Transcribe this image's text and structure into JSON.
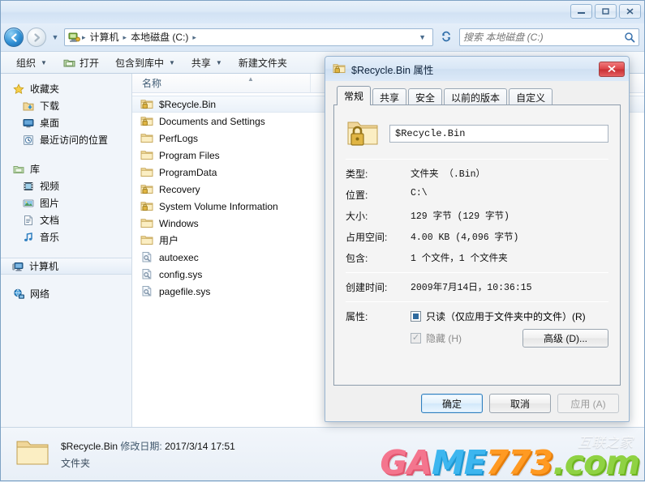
{
  "window": {
    "controls": {
      "minimize": "minimize-icon",
      "maximize": "maximize-icon",
      "close": "close-icon"
    }
  },
  "nav": {
    "back_label": "←",
    "forward_label": "→",
    "history_caret": "▼",
    "refresh_label": "↻",
    "breadcrumbs": [
      "计算机",
      "本地磁盘 (C:)"
    ],
    "separator": "▸"
  },
  "search": {
    "placeholder": "搜索 本地磁盘 (C:)",
    "value": ""
  },
  "toolbar": {
    "items": [
      {
        "label": "组织",
        "caret": true,
        "icon": null
      },
      {
        "label": "打开",
        "caret": false,
        "icon": "open-folder-icon"
      },
      {
        "label": "包含到库中",
        "caret": true,
        "icon": null
      },
      {
        "label": "共享",
        "caret": true,
        "icon": null
      },
      {
        "label": "新建文件夹",
        "caret": false,
        "icon": null
      }
    ]
  },
  "sidebar": {
    "groups": [
      {
        "header": {
          "label": "收藏夹",
          "icon": "star-icon"
        },
        "items": [
          {
            "label": "下载",
            "icon": "downloads-icon"
          },
          {
            "label": "桌面",
            "icon": "desktop-icon"
          },
          {
            "label": "最近访问的位置",
            "icon": "recent-places-icon"
          }
        ]
      },
      {
        "header": {
          "label": "库",
          "icon": "library-icon"
        },
        "items": [
          {
            "label": "视频",
            "icon": "video-icon"
          },
          {
            "label": "图片",
            "icon": "pictures-icon"
          },
          {
            "label": "文档",
            "icon": "documents-icon"
          },
          {
            "label": "音乐",
            "icon": "music-icon"
          }
        ]
      },
      {
        "header": {
          "label": "计算机",
          "icon": "computer-icon",
          "selected": true
        },
        "items": []
      },
      {
        "header": {
          "label": "网络",
          "icon": "network-icon"
        },
        "items": []
      }
    ]
  },
  "filepane": {
    "column_header": "名称",
    "sort_arrow": "▲",
    "rows": [
      {
        "name": "$Recycle.Bin",
        "icon": "locked-folder-icon",
        "selected": true
      },
      {
        "name": "Documents and Settings",
        "icon": "locked-folder-icon",
        "selected": false
      },
      {
        "name": "PerfLogs",
        "icon": "folder-icon",
        "selected": false
      },
      {
        "name": "Program Files",
        "icon": "folder-icon",
        "selected": false
      },
      {
        "name": "ProgramData",
        "icon": "folder-icon",
        "selected": false
      },
      {
        "name": "Recovery",
        "icon": "locked-folder-icon",
        "selected": false
      },
      {
        "name": "System Volume Information",
        "icon": "locked-folder-icon",
        "selected": false
      },
      {
        "name": "Windows",
        "icon": "folder-icon",
        "selected": false
      },
      {
        "name": "用户",
        "icon": "folder-icon",
        "selected": false
      },
      {
        "name": "autoexec",
        "icon": "system-file-icon",
        "selected": false
      },
      {
        "name": "config.sys",
        "icon": "system-file-icon",
        "selected": false
      },
      {
        "name": "pagefile.sys",
        "icon": "system-file-icon",
        "selected": false
      }
    ]
  },
  "details": {
    "icon": "folder-icon",
    "name": "$Recycle.Bin",
    "modified_label": "修改日期:",
    "modified_value": "2017/3/14 17:51",
    "type": "文件夹"
  },
  "watermark": {
    "part1": "GA",
    "part2": "ME",
    "part3": "773",
    "part4": ".com",
    "cn": "互联之家",
    "colors": {
      "part1": "#f4758e",
      "part2": "#3db6ef",
      "part3": "#ff9a22",
      "part4": "#8fd243"
    }
  },
  "dialog": {
    "title": "$Recycle.Bin 属性",
    "title_icon": "locked-folder-icon",
    "close_label": "✕",
    "tabs": [
      {
        "label": "常规",
        "active": true
      },
      {
        "label": "共享",
        "active": false
      },
      {
        "label": "安全",
        "active": false
      },
      {
        "label": "以前的版本",
        "active": false
      },
      {
        "label": "自定义",
        "active": false
      }
    ],
    "name_field": {
      "value": "$Recycle.Bin"
    },
    "properties": [
      {
        "label": "类型:",
        "value": "文件夹 （.Bin）"
      },
      {
        "label": "位置:",
        "value": "C:\\"
      },
      {
        "label": "大小:",
        "value": "129 字节 (129 字节)"
      },
      {
        "label": "占用空间:",
        "value": "4.00 KB (4,096 字节)"
      },
      {
        "label": "包含:",
        "value": "1 个文件，1 个文件夹"
      }
    ],
    "created": {
      "label": "创建时间:",
      "value": "2009年7月14日，10:36:15"
    },
    "attributes": {
      "label": "属性:",
      "readonly": {
        "label": "只读（仅应用于文件夹中的文件）(R)",
        "state": "indeterminate"
      },
      "hidden": {
        "label": "隐藏 (H)",
        "state": "checked-disabled"
      },
      "advanced_button": "高级 (D)..."
    },
    "buttons": [
      {
        "label": "确定",
        "style": "default"
      },
      {
        "label": "取消",
        "style": "normal"
      },
      {
        "label": "应用 (A)",
        "style": "disabled"
      }
    ]
  }
}
